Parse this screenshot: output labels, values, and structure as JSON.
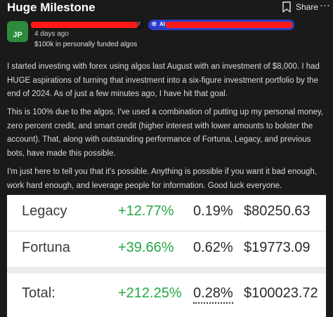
{
  "post": {
    "title": "Huge Milestone",
    "share_label": "Share",
    "more_label": "···",
    "author_initials": "JP",
    "author_name_tail": "y",
    "flair_icon": "⛃",
    "flair_text": "Al",
    "time_ago": "4 days ago",
    "user_flair": "$100k in personally funded algos",
    "paragraphs": [
      "I started investing with forex using algos last August with an investment of $8,000. I had HUGE aspirations of turning that investment into a six-figure investment portfolio by the end of 2024. As of just a few minutes ago, I have hit that goal.",
      "This is 100% due to the algos. I've used a combination of putting up my personal money, zero percent credit, and smart credit (higher interest with lower amounts to bolster the account). That, along with outstanding performance of Fortuna, Legacy, and previous bots, have made this possible.",
      "I'm just here to tell you that it's possible. Anything is possible if you want it bad enough, work hard enough, and leverage people for information. Good luck everyone."
    ]
  },
  "portfolio": {
    "rows": [
      {
        "name": "Legacy",
        "gain": "+12.77%",
        "pct": "0.19%",
        "value": "$80250.63"
      },
      {
        "name": "Fortuna",
        "gain": "+39.66%",
        "pct": "0.62%",
        "value": "$19773.09"
      }
    ],
    "total": {
      "name": "Total:",
      "gain": "+212.25%",
      "pct": "0.28%",
      "value": "$100023.72"
    }
  },
  "colors": {
    "gain_green": "#23a843",
    "redaction_red": "#ff1a1a",
    "flair_blue": "#2c3ec9",
    "avatar_green": "#2e8b3e",
    "background": "#1a1a1a"
  },
  "icons": {
    "bookmark": "bookmark-icon",
    "more": "more-icon",
    "flair": "coin-stack-icon"
  }
}
